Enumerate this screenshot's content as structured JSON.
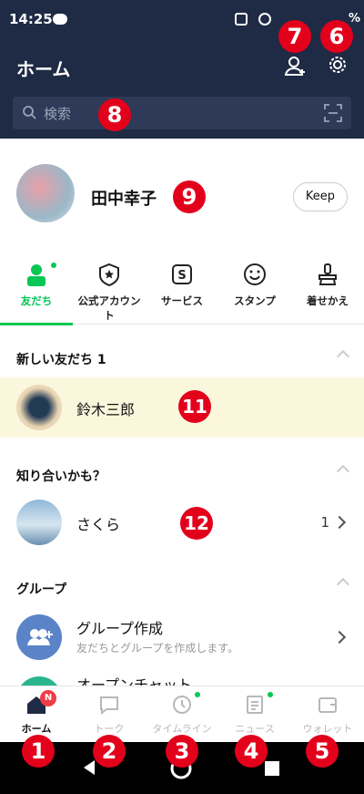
{
  "status": {
    "time": "14:25",
    "battery_pct": "%"
  },
  "header": {
    "title": "ホーム"
  },
  "search": {
    "placeholder": "検索"
  },
  "profile": {
    "name": "田中幸子",
    "keep_label": "Keep"
  },
  "categories": [
    {
      "label": "友だち",
      "active": true
    },
    {
      "label": "公式アカウント"
    },
    {
      "label": "サービス"
    },
    {
      "label": "スタンプ"
    },
    {
      "label": "着せかえ"
    }
  ],
  "sections": {
    "new_friends": {
      "title": "新しい友だち 1",
      "item": "鈴木三郎"
    },
    "know": {
      "title": "知り合いかも？",
      "item": "さくら",
      "count": "1"
    },
    "group": {
      "title": "グループ",
      "create_title": "グループ作成",
      "create_sub": "友だちとグループを作成します。",
      "partial": "オープンチャット"
    }
  },
  "nav": [
    {
      "label": "ホーム",
      "badge": "N",
      "active": true
    },
    {
      "label": "トーク"
    },
    {
      "label": "タイムライン"
    },
    {
      "label": "ニュース"
    },
    {
      "label": "ウォレット"
    }
  ],
  "annotations": [
    "1",
    "2",
    "3",
    "4",
    "5",
    "6",
    "7",
    "8",
    "9",
    "11",
    "12"
  ],
  "colors": {
    "header_bg": "#1f2a44",
    "accent": "#06c755",
    "annotation": "#e3001b",
    "highlight_row": "#fbf7dc"
  }
}
